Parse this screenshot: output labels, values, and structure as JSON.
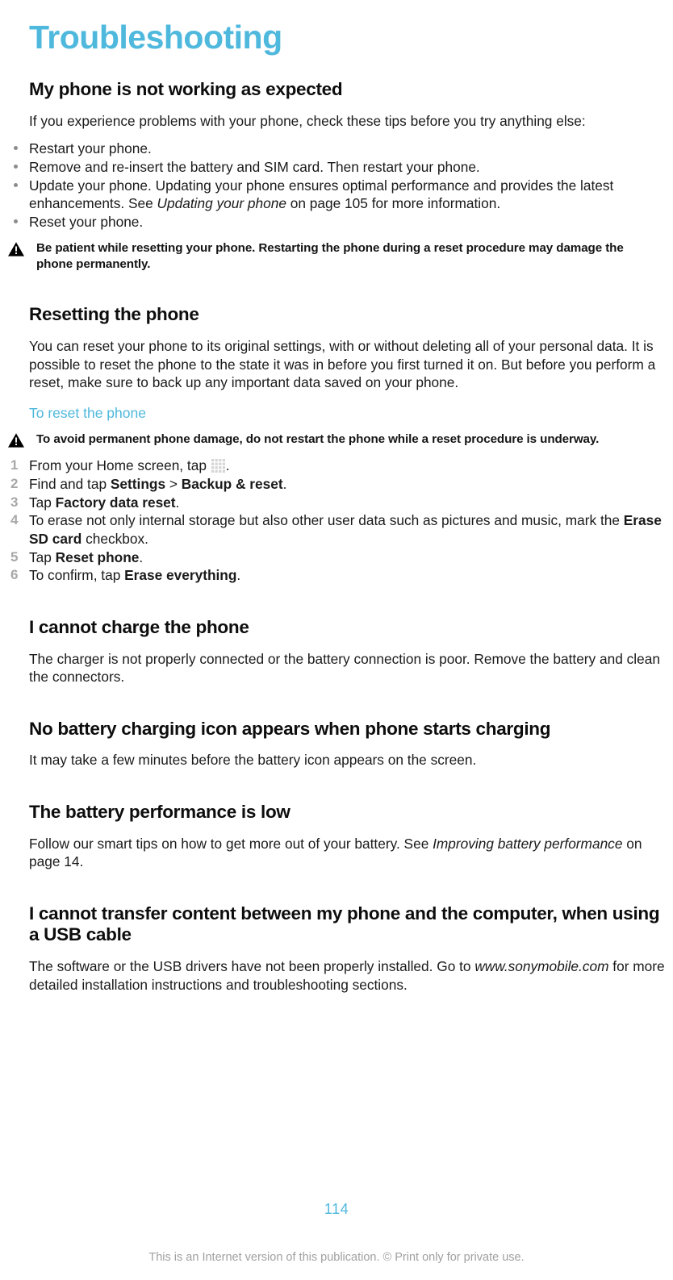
{
  "chapter": {
    "title": "Troubleshooting"
  },
  "colors": {
    "accent": "#4fb8dd",
    "body_text": "#1a1a1a",
    "step_number": "#a8a8a8",
    "bullet": "#8c8c8c",
    "footer": "#a0a0a0"
  },
  "sections": {
    "not_working": {
      "heading": "My phone is not working as expected",
      "intro": "If you experience problems with your phone, check these tips before you try anything else:",
      "bullets": [
        {
          "text": "Restart your phone."
        },
        {
          "text": "Remove and re-insert the battery and SIM card. Then restart your phone."
        },
        {
          "pre": "Update your phone. Updating your phone ensures optimal performance and provides the latest enhancements. See ",
          "italic": "Updating your phone",
          "post": " on page 105 for more information."
        },
        {
          "text": "Reset your phone."
        }
      ],
      "note": "Be patient while resetting your phone. Restarting the phone during a reset procedure may damage the phone permanently."
    },
    "resetting": {
      "heading": "Resetting the phone",
      "body": "You can reset your phone to its original settings, with or without deleting all of your personal data. It is possible to reset the phone to the state it was in before you first turned it on. But before you perform a reset, make sure to back up any important data saved on your phone.",
      "subheading": "To reset the phone",
      "note": "To avoid permanent phone damage, do not restart the phone while a reset procedure is underway.",
      "steps": [
        {
          "number": "1",
          "pre": "From your Home screen, tap ",
          "icon": "apps-grid-icon",
          "post": "."
        },
        {
          "number": "2",
          "pre": "Find and tap ",
          "bold": "Settings",
          "mid": " > ",
          "bold2": "Backup & reset",
          "post": "."
        },
        {
          "number": "3",
          "pre": "Tap ",
          "bold": "Factory data reset",
          "post": "."
        },
        {
          "number": "4",
          "pre": "To erase not only internal storage but also other user data such as pictures and music, mark the ",
          "bold": "Erase SD card",
          "post": " checkbox."
        },
        {
          "number": "5",
          "pre": "Tap ",
          "bold": "Reset phone",
          "post": "."
        },
        {
          "number": "6",
          "pre": "To confirm, tap ",
          "bold": "Erase everything",
          "post": "."
        }
      ]
    },
    "cannot_charge": {
      "heading": "I cannot charge the phone",
      "body": "The charger is not properly connected or the battery connection is poor. Remove the battery and clean the connectors."
    },
    "no_charging_icon": {
      "heading": "No battery charging icon appears when phone starts charging",
      "body": "It may take a few minutes before the battery icon appears on the screen."
    },
    "battery_low": {
      "heading": "The battery performance is low",
      "body_pre": "Follow our smart tips on how to get more out of your battery. See ",
      "body_italic": "Improving battery performance",
      "body_post": " on page 14."
    },
    "cannot_transfer": {
      "heading": "I cannot transfer content between my phone and the computer, when using a USB cable",
      "body_pre": "The software or the USB drivers have not been properly installed. Go to ",
      "body_italic": "www.sonymobile.com",
      "body_post": " for more detailed installation instructions and troubleshooting sections."
    }
  },
  "footer": {
    "page_number": "114",
    "notice": "This is an Internet version of this publication. © Print only for private use."
  }
}
